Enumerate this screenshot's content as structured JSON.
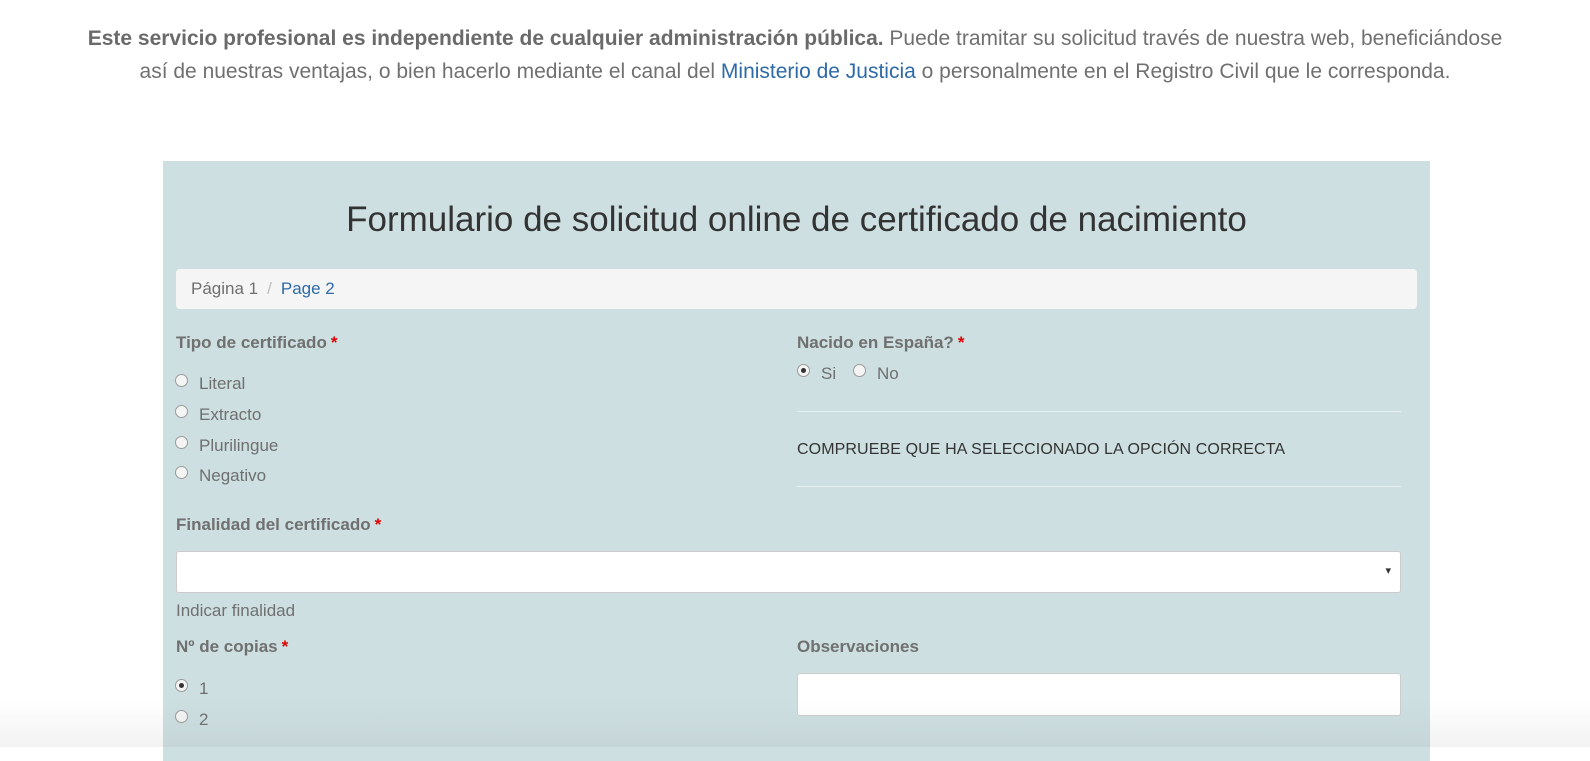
{
  "intro": {
    "bold_text": "Este servicio profesional es independiente de cualquier administración pública.",
    "text_1": " Puede tramitar su solicitud través de nuestra web, beneficiándose así de nuestras ventajas, o bien hacerlo mediante el canal del ",
    "link_text": "Ministerio de Justicia",
    "text_2": " o personalmente en el Registro Civil que le corresponda."
  },
  "form": {
    "title": "Formulario de solicitud online de certificado de nacimiento",
    "breadcrumb": {
      "page1": "Página 1",
      "separator": "/",
      "page2": "Page 2"
    },
    "required_mark": "*",
    "tipo_certificado": {
      "label": "Tipo de certificado",
      "options": [
        "Literal",
        "Extracto",
        "Plurilingue",
        "Negativo"
      ],
      "selected": null
    },
    "nacido_espana": {
      "label": "Nacido en España?",
      "options": [
        "Si",
        "No"
      ],
      "selected": "Si"
    },
    "notice": "COMPRUEBE QUE HA SELECCIONADO LA OPCIÓN CORRECTA",
    "finalidad": {
      "label": "Finalidad del certificado",
      "value": "",
      "arrow": "▾",
      "help": "Indicar finalidad"
    },
    "copias": {
      "label": "Nº de copias",
      "options": [
        "1",
        "2"
      ],
      "selected": "1"
    },
    "observaciones": {
      "label": "Observaciones",
      "value": ""
    }
  },
  "colors": {
    "panel_bg": "#cddfe1",
    "link": "#2d6aa8",
    "required": "#e00000"
  }
}
